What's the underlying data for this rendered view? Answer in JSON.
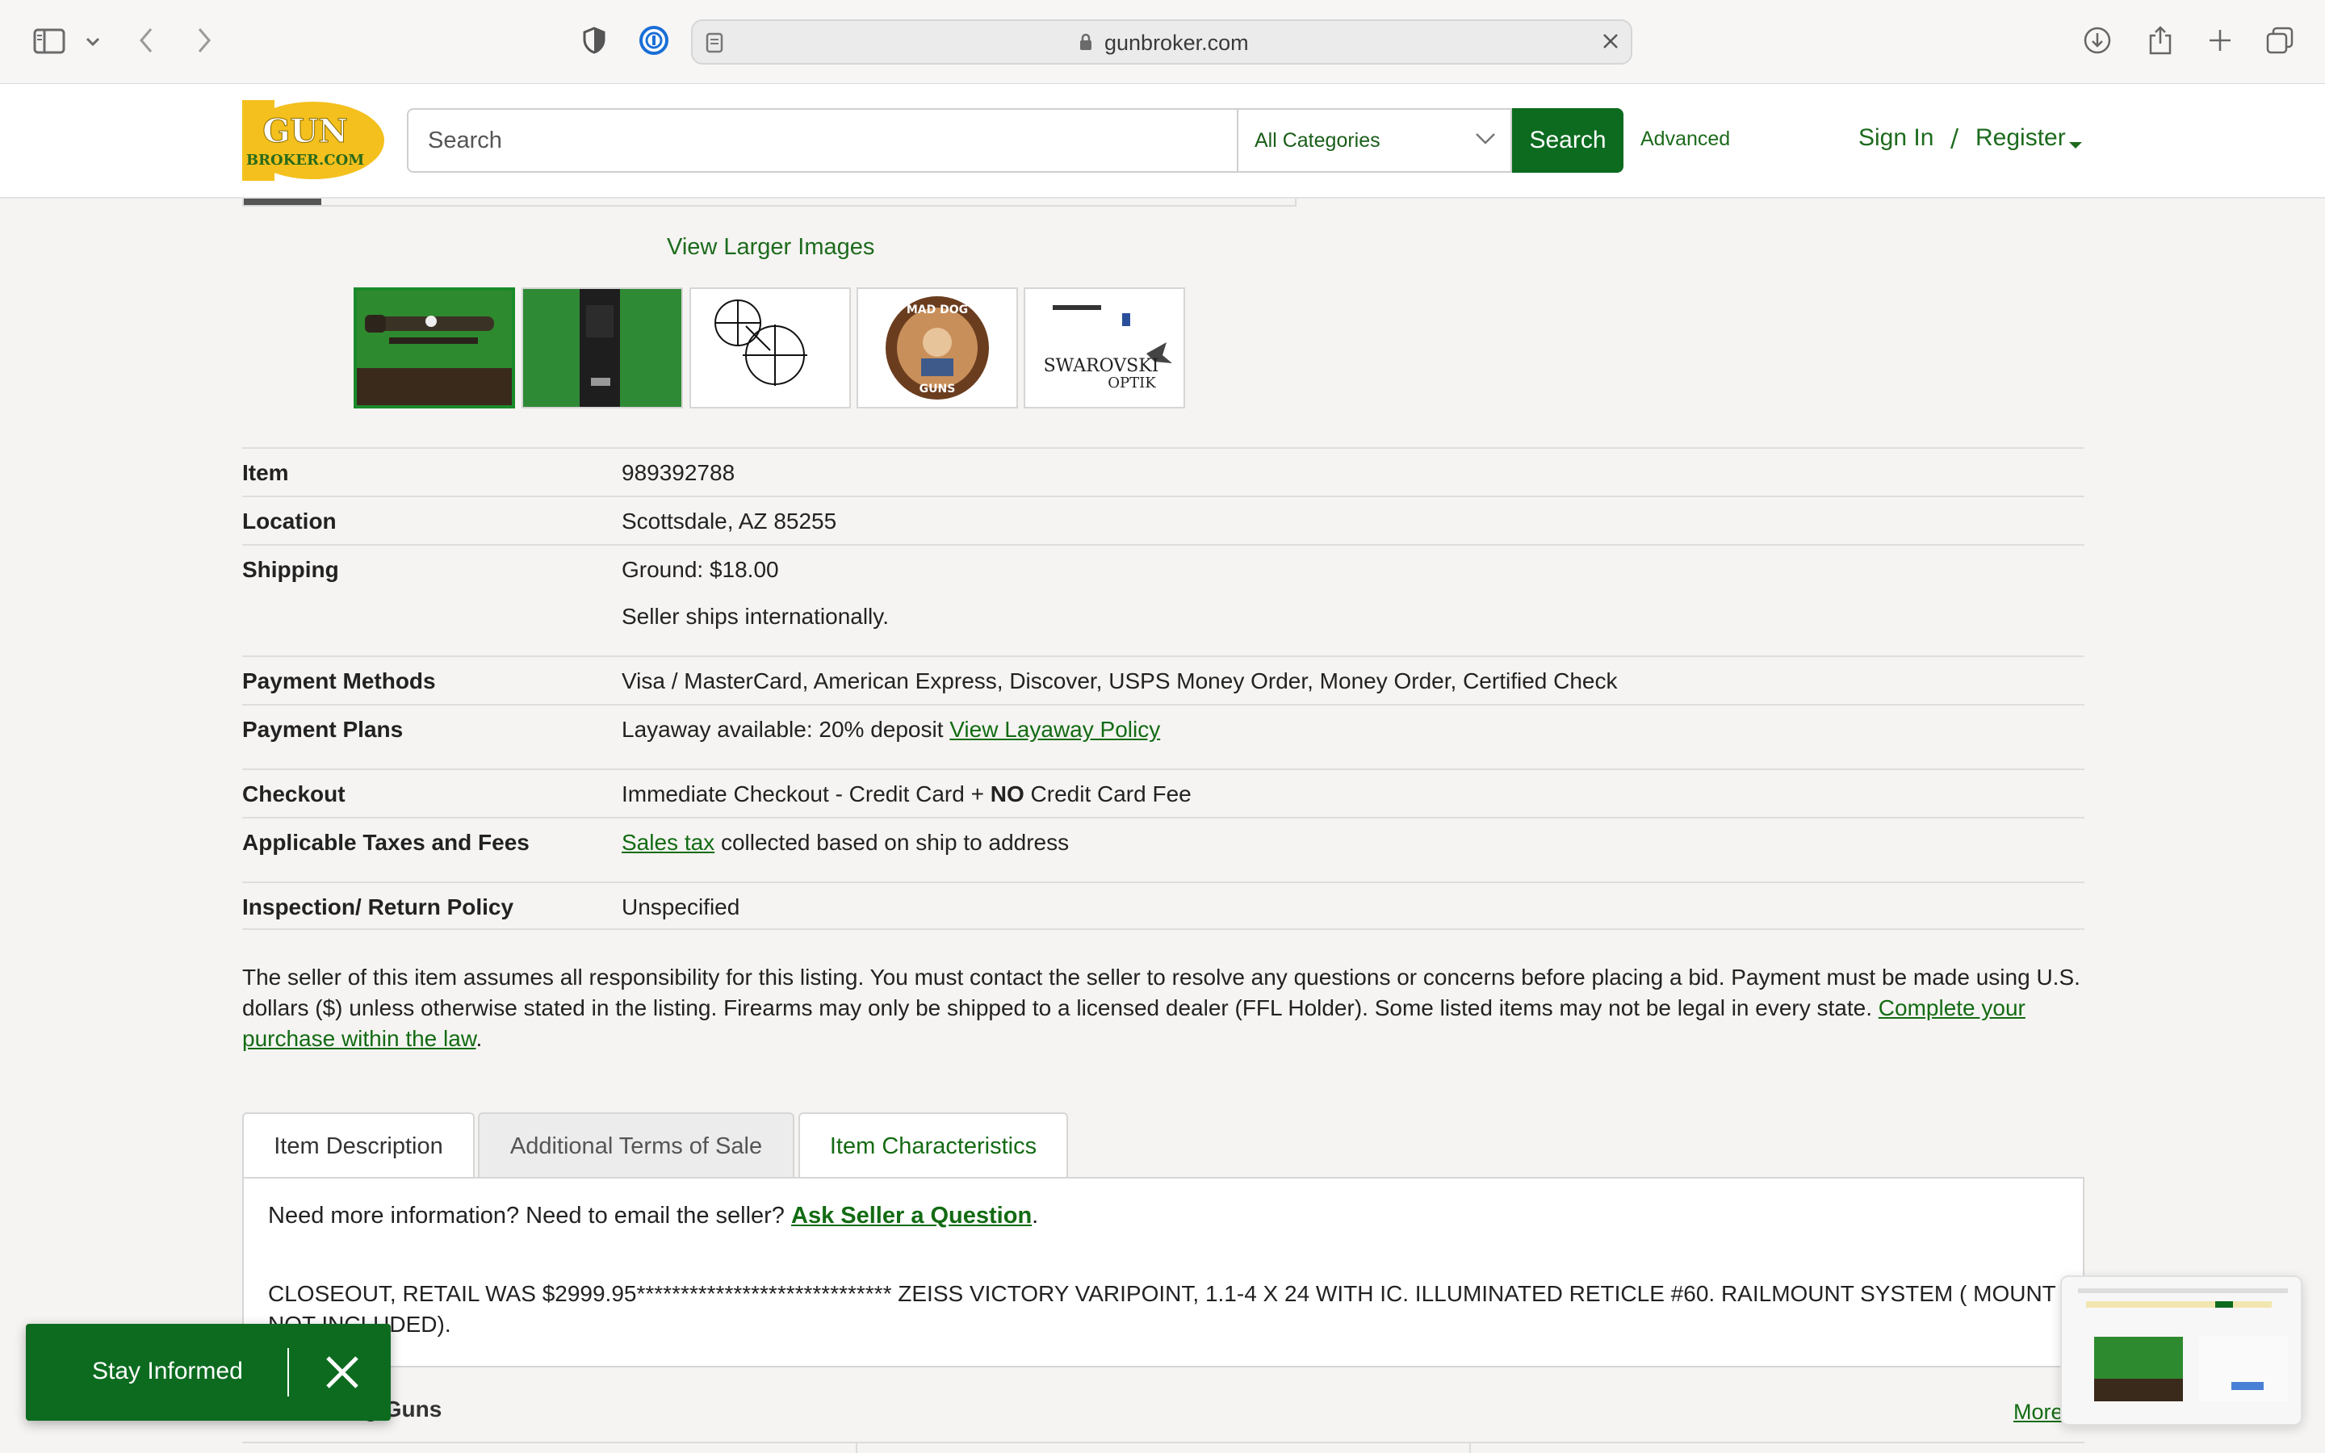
{
  "browser": {
    "url": "gunbroker.com"
  },
  "header": {
    "logo_top": "GUN",
    "logo_bottom": "BROKER.COM",
    "search_placeholder": "Search",
    "category": "All Categories",
    "search_button": "Search",
    "advanced": "Advanced",
    "sign_in": "Sign In",
    "divider": "/",
    "register": "Register"
  },
  "gallery": {
    "view_larger": "View Larger Images",
    "thumb5_line1": "SWAROVSKI",
    "thumb5_line2": "OPTIK",
    "thumb4_top": "MAD DOG",
    "thumb4_bottom": "GUNS"
  },
  "details": {
    "item_label": "Item",
    "item_value": "989392788",
    "location_label": "Location",
    "location_value": "Scottsdale, AZ 85255",
    "shipping_label": "Shipping",
    "shipping_value": "Ground: $18.00",
    "shipping_note": "Seller ships internationally.",
    "payment_methods_label": "Payment Methods",
    "payment_methods_value": "Visa / MasterCard, American Express, Discover, USPS Money Order, Money Order, Certified Check",
    "payment_plans_label": "Payment Plans",
    "payment_plans_value": "Layaway available: 20% deposit",
    "payment_plans_link": "View Layaway Policy",
    "checkout_label": "Checkout",
    "checkout_pre": "Immediate Checkout - Credit Card + ",
    "checkout_bold": "NO",
    "checkout_post": " Credit Card Fee",
    "taxes_label": "Applicable Taxes and Fees",
    "taxes_link": "Sales tax",
    "taxes_value": " collected based on ship to address",
    "inspection_label": "Inspection/ Return Policy",
    "inspection_value": "Unspecified"
  },
  "disclaimer": {
    "text": "The seller of this item assumes all responsibility for this listing. You must contact the seller to resolve any questions or concerns before placing a bid. Payment must be made using U.S. dollars ($) unless otherwise stated in the listing. Firearms may only be shipped to a licensed dealer (FFL Holder). Some listed items may not be legal in every state.",
    "link": "Complete your purchase within the law",
    "period": "."
  },
  "tabs": {
    "description": "Item Description",
    "terms": "Additional Terms of Sale",
    "characteristics": "Item Characteristics"
  },
  "description": {
    "question_pre": "Need more information? Need to email the seller? ",
    "question_link": "Ask Seller a Question",
    "question_post": ".",
    "body": "CLOSEOUT, RETAIL WAS $2999.95***************************** ZEISS VICTORY VARIPOINT, 1.1-4 X 24 WITH IC. ILLUMINATED RETICLE #60. RAILMOUNT SYSTEM ( MOUNT NOT INCLUDED)."
  },
  "more_section": {
    "title": "om Mad Dog Guns",
    "more_link": "More"
  },
  "toast": {
    "text": "Stay Informed"
  },
  "colors": {
    "brand_green": "#0c6b1f",
    "link_green": "#136b13",
    "logo_yellow": "#f4c01e"
  }
}
